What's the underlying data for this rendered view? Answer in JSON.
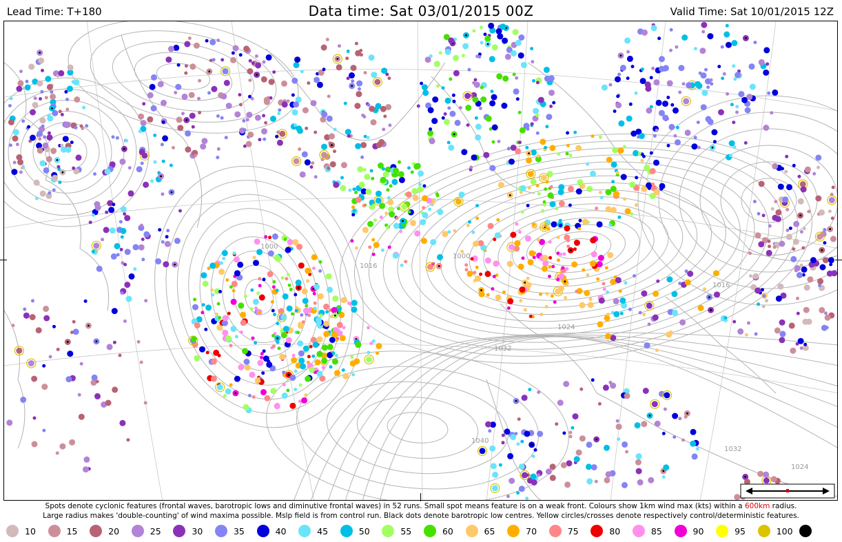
{
  "header": {
    "lead_time": "Lead Time: T+180",
    "data_time": "Data time:  Sat 03/01/2015 00Z",
    "valid_time": "Valid Time: Sat 10/01/2015 12Z"
  },
  "caption": {
    "line1_a": "Spots denote cyclonic features (frontal waves, barotropic lows and diminutive frontal waves) in 52 runs. Small spot means feature is on a weak front. Colours show 1km wind max (kts) within a ",
    "radius": "600km",
    "line1_b": " radius.",
    "line2": "Large radius makes 'double-counting' of wind maxima possible. Mslp field is from control run. Black dots denote barotropic low centres. Yellow circles/crosses denote respectively control/deterministic features."
  },
  "isobar_labels": [
    "1000",
    "1016",
    "1000",
    "1032",
    "1024",
    "1040",
    "1032",
    "1024",
    "1016"
  ],
  "legend": [
    {
      "label": "10",
      "color": "#d3b9b9"
    },
    {
      "label": "15",
      "color": "#cc8f9a"
    },
    {
      "label": "20",
      "color": "#b86374"
    },
    {
      "label": "25",
      "color": "#b283d6"
    },
    {
      "label": "30",
      "color": "#8b31b8"
    },
    {
      "label": "35",
      "color": "#8484f4"
    },
    {
      "label": "40",
      "color": "#0000dd"
    },
    {
      "label": "45",
      "color": "#6ae4fb"
    },
    {
      "label": "50",
      "color": "#00bfe7"
    },
    {
      "label": "55",
      "color": "#a3ff61"
    },
    {
      "label": "60",
      "color": "#45e000"
    },
    {
      "label": "65",
      "color": "#ffc869"
    },
    {
      "label": "70",
      "color": "#ffae00"
    },
    {
      "label": "75",
      "color": "#ff8787"
    },
    {
      "label": "80",
      "color": "#ee0000"
    },
    {
      "label": "85",
      "color": "#ff90ee"
    },
    {
      "label": "90",
      "color": "#f000d6"
    },
    {
      "label": "95",
      "color": "#ffff00"
    },
    {
      "label": "100",
      "color": "#d9c400"
    },
    {
      "label": "",
      "color": "#000000"
    }
  ]
}
